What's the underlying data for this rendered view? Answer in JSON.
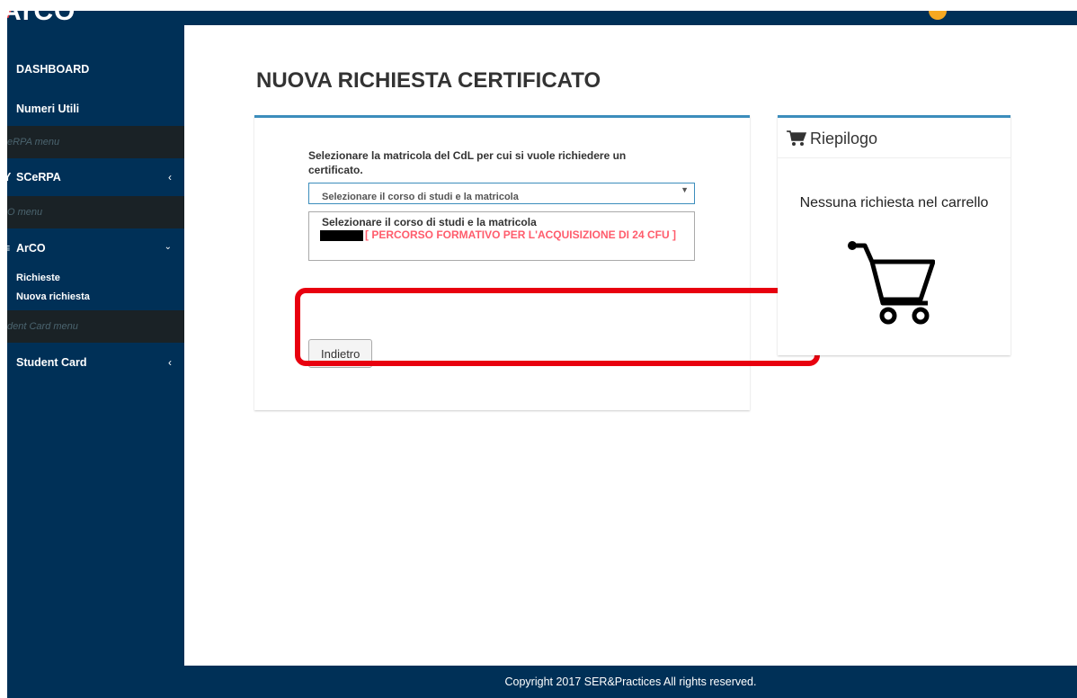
{
  "app": {
    "logo": "ArCO"
  },
  "sidebar": {
    "dashboard": "DASHBOARD",
    "numeri_utili": "Numeri Utili",
    "scerpa_header": "eRPA menu",
    "scerpa": "SCeRPA",
    "arco_header": "O menu",
    "arco": "ArCO",
    "richieste": "Richieste",
    "nuova_richiesta": "Nuova richiesta",
    "student_header": "dent Card menu",
    "student_card": "Student Card"
  },
  "main": {
    "page_title": "NUOVA RICHIESTA CERTIFICATO",
    "instruction": "Selezionare la matricola del CdL per cui si vuole richiedere un certificato.",
    "select_value": "Selezionare il corso di studi e la matricola",
    "dropdown_options": [
      "Selezionare il corso di studi e la matricola",
      "[ PERCORSO FORMATIVO PER L'ACQUISIZIONE DI 24 CFU ]"
    ],
    "back_button": "Indietro"
  },
  "summary": {
    "title": "Riepilogo",
    "empty_message": "Nessuna richiesta nel carrello"
  },
  "footer": {
    "copyright": "Copyright 2017 SER&Practices All rights reserved."
  },
  "colors": {
    "sidebar": "#003057",
    "accent": "#3c8dbc",
    "highlight": "#e8000f",
    "option_red": "#ff5c6c"
  }
}
